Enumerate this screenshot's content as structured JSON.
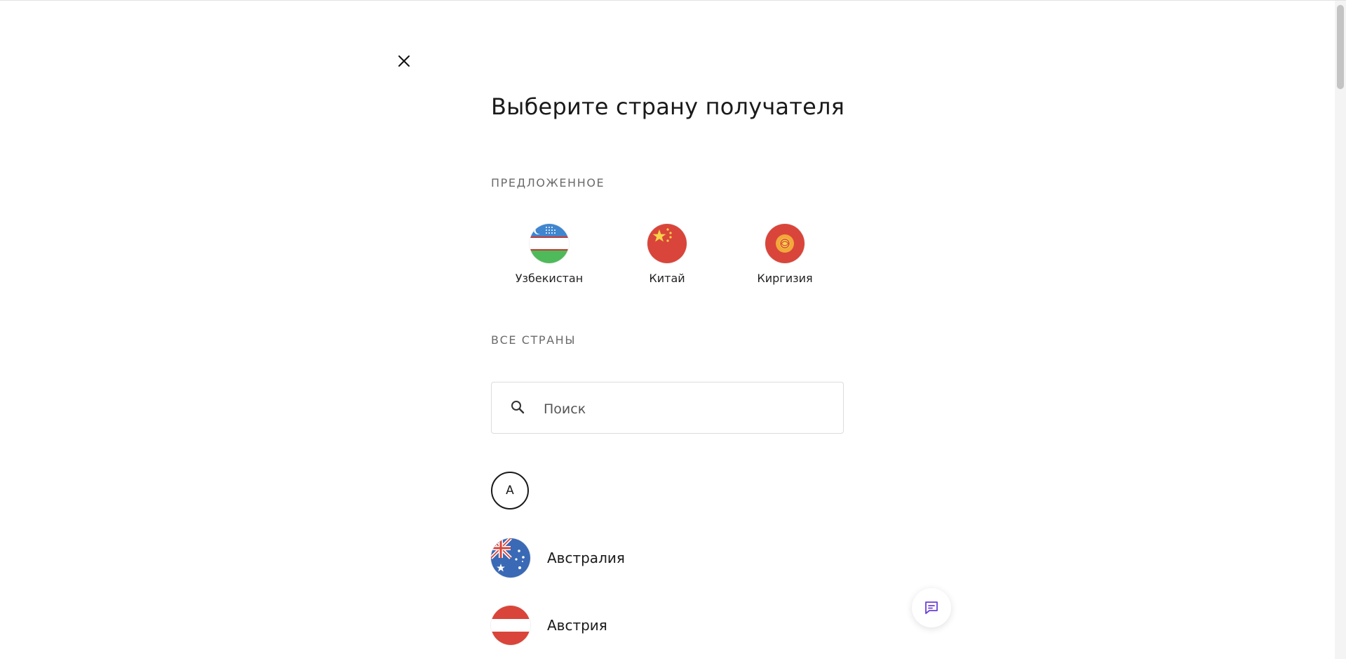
{
  "page": {
    "title": "Выберите страну получателя"
  },
  "suggested": {
    "label": "ПРЕДЛОЖЕННОЕ",
    "items": [
      {
        "name": "Узбекистан",
        "flag": "uzbekistan-flag"
      },
      {
        "name": "Китай",
        "flag": "china-flag"
      },
      {
        "name": "Киргизия",
        "flag": "kyrgyzstan-flag"
      }
    ]
  },
  "all_countries": {
    "label": "ВСЕ СТРАНЫ",
    "search_placeholder": "Поиск",
    "search_value": "",
    "groups": [
      {
        "letter": "А",
        "countries": [
          {
            "name": "Австралия",
            "flag": "australia-flag"
          },
          {
            "name": "Австрия",
            "flag": "austria-flag"
          }
        ]
      }
    ]
  },
  "icons": {
    "close": "close-icon",
    "search": "search-icon",
    "chat": "chat-icon"
  },
  "colors": {
    "accent": "#6b3fd6",
    "text": "#1a1a1a",
    "muted": "#6b6b6b",
    "border": "#dcdcdc"
  }
}
